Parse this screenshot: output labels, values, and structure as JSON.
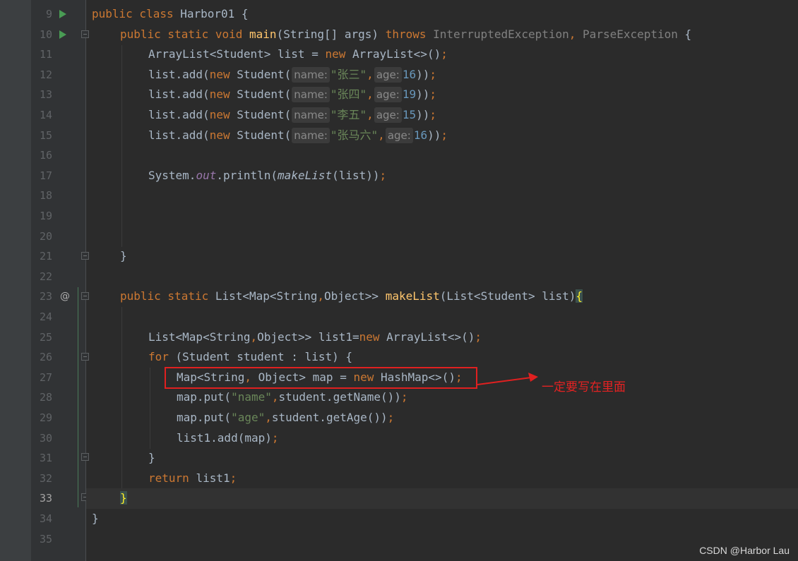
{
  "editor": {
    "line_numbers": [
      "9",
      "10",
      "11",
      "12",
      "13",
      "14",
      "15",
      "16",
      "17",
      "18",
      "19",
      "20",
      "21",
      "22",
      "23",
      "24",
      "25",
      "26",
      "27",
      "28",
      "29",
      "30",
      "31",
      "32",
      "33",
      "34",
      "35"
    ],
    "current_line": "33",
    "gutter_icons": {
      "run": "run-triangle-icon",
      "fold": "fold-marker-icon",
      "override_marker": "@"
    },
    "code": {
      "l9": {
        "t1": "public class ",
        "t2": "Harbor01 {"
      },
      "l10": {
        "t1": "public static void ",
        "t2": "main",
        "t3": "(String[] args) ",
        "t4": "throws ",
        "t5": "InterruptedException",
        "t6": ", ",
        "t7": "ParseException",
        "t8": " {"
      },
      "l11": {
        "t1": "ArrayList<Student> list = ",
        "t2": "new ",
        "t3": "ArrayList<>()",
        "t4": ";"
      },
      "l12": {
        "t1": "list.add(",
        "t2": "new ",
        "t3": "Student(",
        "h1": "name:",
        "s1": "\"张三\"",
        "c1": ",",
        "h2": "age:",
        "n1": "16",
        "t4": "))",
        "t5": ";"
      },
      "l13": {
        "t1": "list.add(",
        "t2": "new ",
        "t3": "Student(",
        "h1": "name:",
        "s1": "\"张四\"",
        "c1": ",",
        "h2": "age:",
        "n1": "19",
        "t4": "))",
        "t5": ";"
      },
      "l14": {
        "t1": "list.add(",
        "t2": "new ",
        "t3": "Student(",
        "h1": "name:",
        "s1": "\"李五\"",
        "c1": ",",
        "h2": "age:",
        "n1": "15",
        "t4": "))",
        "t5": ";"
      },
      "l15": {
        "t1": "list.add(",
        "t2": "new ",
        "t3": "Student(",
        "h1": "name:",
        "s1": "\"张马六\"",
        "c1": ",",
        "h2": "age:",
        "n1": "16",
        "t4": "))",
        "t5": ";"
      },
      "l17": {
        "t1": "System.",
        "t2": "out",
        "t3": ".println(",
        "t4": "makeList",
        "t5": "(list))",
        "t6": ";"
      },
      "l21": {
        "t1": "}"
      },
      "l23": {
        "t1": "public static ",
        "t2": "List<Map<String",
        "t3": ",",
        "t4": "Object>> ",
        "t5": "makeList",
        "t6": "(List<Student> list)",
        "t7": "{"
      },
      "l25": {
        "t1": "List<Map<String",
        "t2": ",",
        "t3": "Object>> list1=",
        "t4": "new ",
        "t5": "ArrayList<>()",
        "t6": ";"
      },
      "l26": {
        "t1": "for ",
        "t2": "(Student student : list) {"
      },
      "l27": {
        "t1": "Map<String",
        "t2": ", ",
        "t3": "Object> map = ",
        "t4": "new ",
        "t5": "HashMap<>()",
        "t6": ";"
      },
      "l28": {
        "t1": "map.put(",
        "t2": "\"name\"",
        "t3": ",",
        "t4": "student.getName())",
        "t5": ";"
      },
      "l29": {
        "t1": "map.put(",
        "t2": "\"age\"",
        "t3": ",",
        "t4": "student.getAge())",
        "t5": ";"
      },
      "l30": {
        "t1": "list1.add(map)",
        "t2": ";"
      },
      "l31": {
        "t1": "}"
      },
      "l32": {
        "t1": "return ",
        "t2": "list1",
        "t3": ";"
      },
      "l33": {
        "t1": "}"
      },
      "l34": {
        "t1": "}"
      }
    }
  },
  "annotation": {
    "text": "一定要写在里面",
    "color": "#e52222"
  },
  "watermark": "CSDN @Harbor Lau",
  "colors": {
    "background": "#2b2b2b",
    "gutter": "#313335",
    "keyword": "#cc7832",
    "function": "#ffc66d",
    "string": "#6a8759",
    "number": "#6897bb",
    "field": "#9876aa",
    "default_text": "#a9b7c6",
    "run_icon": "#499c54"
  }
}
